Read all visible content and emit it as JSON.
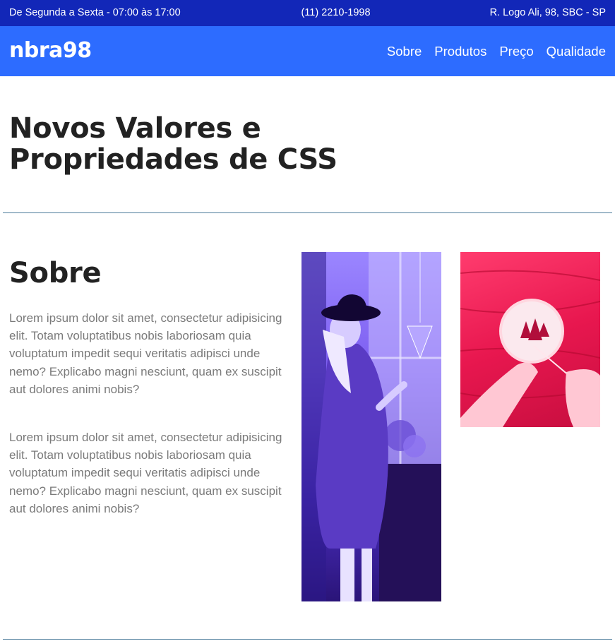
{
  "topbar": {
    "hours": "De Segunda a Sexta - 07:00 às 17:00",
    "phone": "(11) 2210-1998",
    "address": "R. Logo Ali, 98, SBC - SP"
  },
  "header": {
    "logo": "nbra98",
    "nav": [
      "Sobre",
      "Produtos",
      "Preço",
      "Qualidade"
    ]
  },
  "page": {
    "title": "Novos Valores e Propriedades de CSS"
  },
  "about": {
    "title": "Sobre",
    "paragraphs": [
      "Lorem ipsum dolor sit amet, consectetur adipisicing elit. Totam voluptatibus nobis laboriosam quia voluptatum impedit sequi veritatis adipisci unde nemo? Explicabo magni nesciunt, quam ex suscipit aut dolores animi nobis?",
      "Lorem ipsum dolor sit amet, consectetur adipisicing elit. Totam voluptatibus nobis laboriosam quia voluptatum impedit sequi veritatis adipisci unde nemo? Explicabo magni nesciunt, quam ex suscipit aut dolores animi nobis?"
    ]
  },
  "colors": {
    "topbar": "#1227b8",
    "header": "#2d6cff",
    "divider": "#4a7a99"
  },
  "images": {
    "tall": "woman-with-hat-photo",
    "short": "hands-with-embroidery-hoop-photo"
  }
}
